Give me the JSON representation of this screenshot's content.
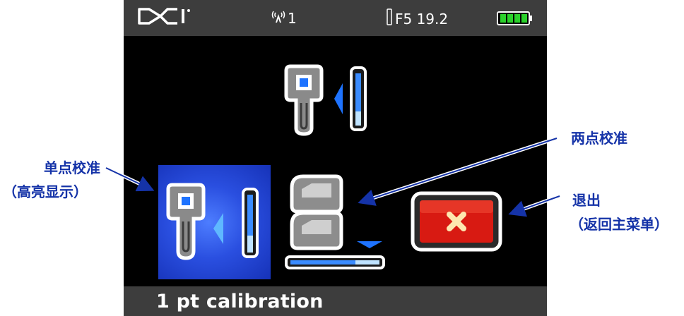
{
  "status_bar": {
    "logo_text": "DCI",
    "signal_channel": "1",
    "frequency": "F5 19.2"
  },
  "footer": {
    "mode_label": "1 pt calibration"
  },
  "menu": {
    "items": [
      {
        "name": "1 pt calibration",
        "selected": true
      },
      {
        "name": "2 pt calibration",
        "selected": false
      },
      {
        "name": "exit",
        "selected": false
      },
      {
        "name": "top calibration",
        "selected": false
      }
    ]
  },
  "annotations": {
    "one_point": "单点校准",
    "one_point_sub": "（高亮显示）",
    "two_point": "两点校准",
    "exit": "退出",
    "exit_sub": "（返回主菜单）"
  },
  "colors": {
    "selection": "#2a4fe0",
    "exit_red": "#d81a12",
    "annotation": "#1533a8",
    "battery_green": "#2bd12b"
  }
}
